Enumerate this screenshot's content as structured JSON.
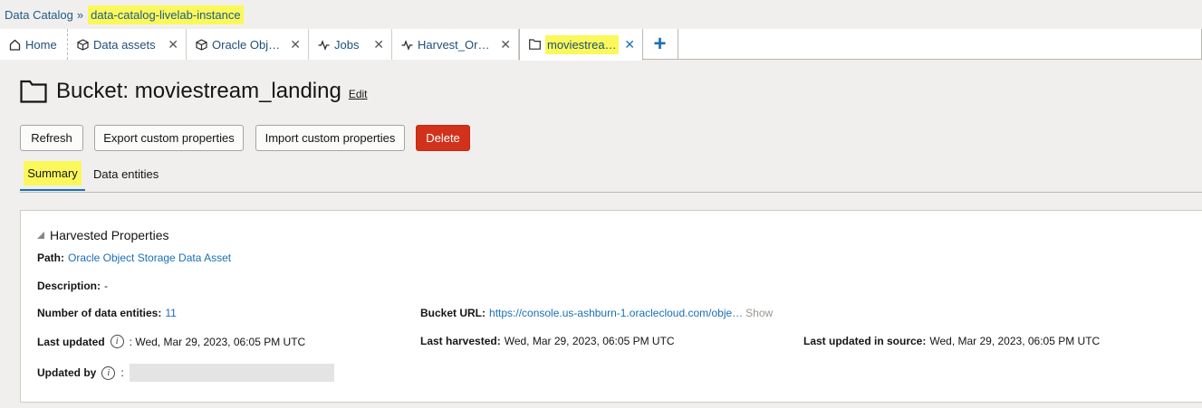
{
  "breadcrumb": {
    "root": "Data Catalog",
    "separator": "»",
    "current": "data-catalog-livelab-instance"
  },
  "tabs": [
    {
      "label": "Home",
      "icon": "home-icon"
    },
    {
      "label": "Data assets",
      "icon": "cube-icon"
    },
    {
      "label": "Oracle Obj…",
      "icon": "cube-icon"
    },
    {
      "label": "Jobs",
      "icon": "activity-icon"
    },
    {
      "label": "Harvest_Or…",
      "icon": "activity-icon"
    },
    {
      "label": "moviestrea…",
      "icon": "folder-icon",
      "active": true
    }
  ],
  "add_tab": "+",
  "page": {
    "title": "Bucket: moviestream_landing",
    "edit": "Edit"
  },
  "actions": {
    "refresh": "Refresh",
    "export": "Export custom properties",
    "import": "Import custom properties",
    "delete": "Delete"
  },
  "subtabs": {
    "summary": "Summary",
    "data_entities": "Data entities"
  },
  "harvested": {
    "title": "Harvested Properties",
    "path_label": "Path:",
    "path_value": "Oracle Object Storage Data Asset",
    "description_label": "Description:",
    "description_value": "-",
    "num_entities_label": "Number of data entities:",
    "num_entities_value": "11",
    "bucket_url_label": "Bucket URL:",
    "bucket_url_value": "https://console.us-ashburn-1.oraclecloud.com/obje…",
    "show": "Show",
    "last_updated_label": "Last updated",
    "last_updated_value": ": Wed, Mar 29, 2023, 06:05 PM UTC",
    "last_harvested_label": "Last harvested:",
    "last_harvested_value": "Wed, Mar 29, 2023, 06:05 PM UTC",
    "last_updated_source_label": "Last updated in source:",
    "last_updated_source_value": "Wed, Mar 29, 2023, 06:05 PM UTC",
    "updated_by_label": "Updated by",
    "updated_by_sep": ":"
  },
  "colors": {
    "accent": "#1a6fb5",
    "danger": "#d2311b",
    "highlight": "#faf85a"
  }
}
